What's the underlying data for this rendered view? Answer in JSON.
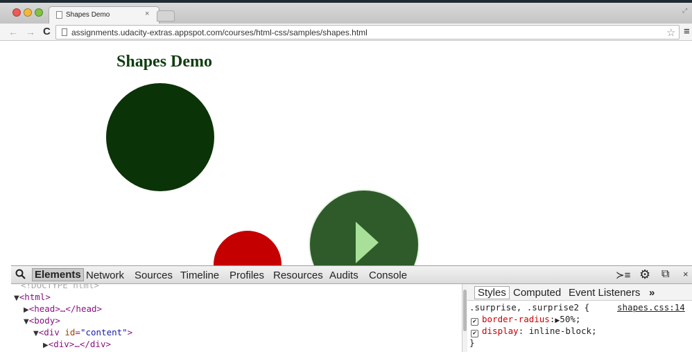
{
  "browser": {
    "tab_title": "Shapes Demo",
    "tab_close": "×",
    "url": "assignments.udacity-extras.appspot.com/courses/html-css/samples/shapes.html"
  },
  "icons": {
    "back": "←",
    "forward": "→",
    "reload": "C",
    "star": "☆",
    "menu": "≡",
    "fullscreen": "⤢",
    "search": "🔍",
    "console_drawer": "≻≡",
    "gear": "⚙",
    "dock": "⧉",
    "close": "×"
  },
  "page": {
    "title": "Shapes Demo",
    "colors": {
      "title": "#0f3d0f",
      "dark_circle": "#0b3308",
      "red_circle": "#c40000",
      "play_circle": "#2f5a2a",
      "play_triangle": "#a8e09a"
    }
  },
  "devtools": {
    "tabs": [
      "Elements",
      "Network",
      "Sources",
      "Timeline",
      "Profiles",
      "Resources",
      "Audits",
      "Console"
    ],
    "active_tab": "Elements",
    "tree": {
      "doctype": "<!DOCTYPE html>",
      "html_open": "<html>",
      "head": "<head>…</head>",
      "body_open": "<body>",
      "div_open_tag": "<div ",
      "div_attr_name": "id",
      "div_attr_value": "\"content\"",
      "div_close_bracket": ">",
      "child_div": "<div>…</div>"
    },
    "styles": {
      "tabs": [
        "Styles",
        "Computed",
        "Event Listeners",
        "»"
      ],
      "selector": ".surprise, .surprise2 {",
      "source": "shapes.css:14",
      "properties": [
        {
          "name": "border-radius",
          "value": "50%;"
        },
        {
          "name": "display",
          "value": "inline-block;"
        }
      ],
      "close": "}"
    }
  }
}
